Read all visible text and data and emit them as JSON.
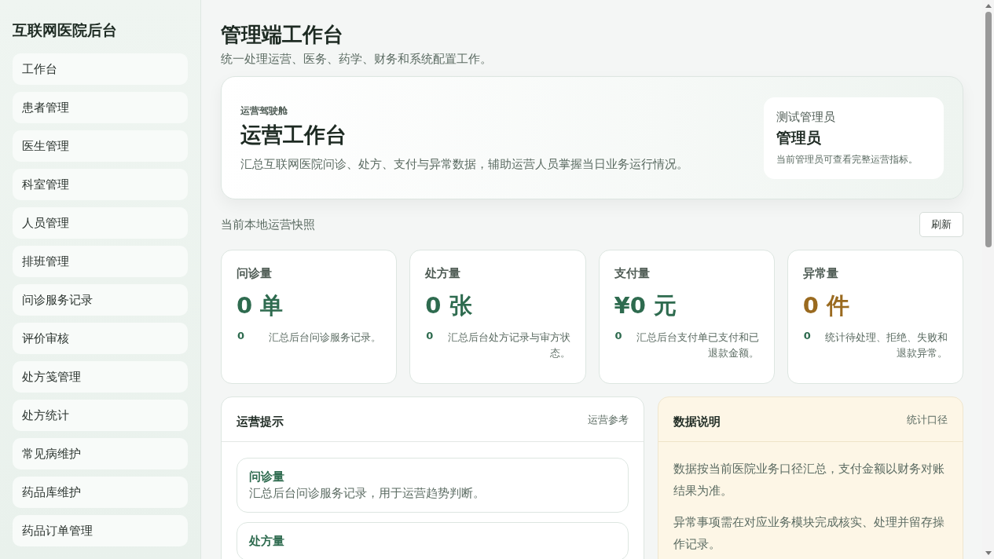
{
  "sidebar": {
    "title": "互联网医院后台",
    "items": [
      {
        "label": "工作台",
        "selected": false
      },
      {
        "label": "患者管理",
        "selected": false
      },
      {
        "label": "医生管理",
        "selected": false
      },
      {
        "label": "科室管理",
        "selected": false
      },
      {
        "label": "人员管理",
        "selected": false
      },
      {
        "label": "排班管理",
        "selected": false
      },
      {
        "label": "问诊服务记录",
        "selected": false
      },
      {
        "label": "评价审核",
        "selected": false
      },
      {
        "label": "处方笺管理",
        "selected": false
      },
      {
        "label": "处方统计",
        "selected": false
      },
      {
        "label": "常见病维护",
        "selected": false
      },
      {
        "label": "药品库维护",
        "selected": false
      },
      {
        "label": "药品订单管理",
        "selected": false
      }
    ]
  },
  "page": {
    "title": "管理端工作台",
    "subtitle": "统一处理运营、医务、药学、财务和系统配置工作。"
  },
  "hero": {
    "eyebrow": "运营驾驶舱",
    "title": "运营工作台",
    "description": "汇总互联网医院问诊、处方、支付与异常数据，辅助运营人员掌握当日业务运行情况。",
    "user": {
      "account": "测试管理员",
      "role": "管理员",
      "note": "当前管理员可查看完整运营指标。"
    }
  },
  "snapshot": {
    "label": "当前本地运营快照",
    "refresh": "刷新"
  },
  "metrics": [
    {
      "label": "问诊量",
      "value": "0 单",
      "count": "0",
      "description": "汇总后台问诊服务记录。",
      "color": "#2e6b4f"
    },
    {
      "label": "处方量",
      "value": "0 张",
      "count": "0",
      "description": "汇总后台处方记录与审方状态。",
      "color": "#2e6b4f"
    },
    {
      "label": "支付量",
      "value": "¥0 元",
      "count": "0",
      "description": "汇总后台支付单已支付和已退款金额。",
      "color": "#2e6b4f"
    },
    {
      "label": "异常量",
      "value": "0 件",
      "count": "0",
      "description": "统计待处理、拒绝、失败和退款异常。",
      "color": "#9a6a1f"
    }
  ],
  "tips": {
    "title": "运营提示",
    "tag": "运营参考",
    "items": [
      {
        "title": "问诊量",
        "text": "汇总后台问诊服务记录，用于运营趋势判断。"
      },
      {
        "title": "处方量"
      }
    ]
  },
  "notes": {
    "title": "数据说明",
    "tag": "统计口径",
    "paragraphs": [
      "数据按当前医院业务口径汇总，支付金额以财务对账结果为准。",
      "异常事项需在对应业务模块完成核实、处理并留存操作记录。"
    ]
  }
}
